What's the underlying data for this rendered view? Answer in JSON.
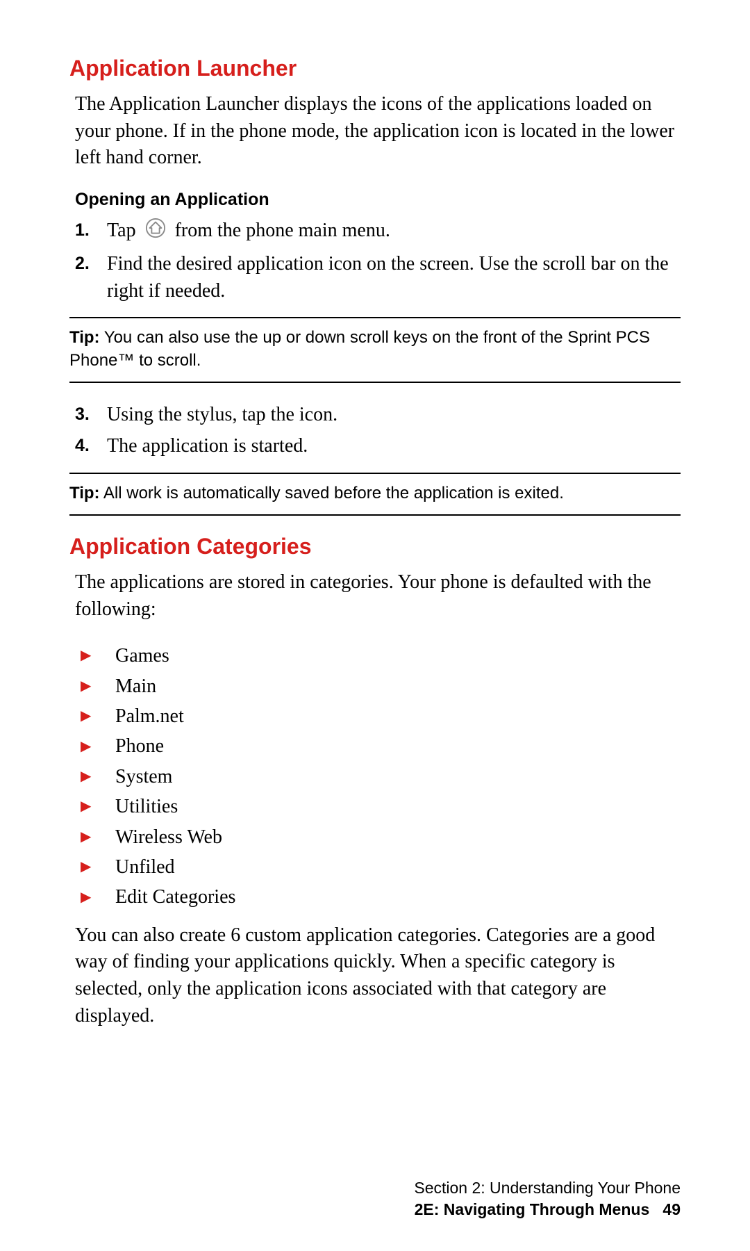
{
  "heading1": "Application Launcher",
  "intro1": "The Application Launcher displays the icons of the applications loaded on your phone. If in the phone mode, the application icon is located in the lower left hand corner.",
  "subheading1": "Opening an Application",
  "steps_a": [
    {
      "num": "1.",
      "pre": "Tap",
      "post": "from the phone main menu."
    },
    {
      "num": "2.",
      "text": "Find the desired application icon on the screen. Use the scroll bar on the right if needed."
    }
  ],
  "tip1_label": "Tip:",
  "tip1_text": "You can also use the up or down scroll keys on the front of the Sprint PCS Phone™ to scroll.",
  "steps_b": [
    {
      "num": "3.",
      "text": "Using the stylus, tap the icon."
    },
    {
      "num": "4.",
      "text": "The application is started."
    }
  ],
  "tip2_label": "Tip:",
  "tip2_text": "All work is automatically saved before the application is exited.",
  "heading2": "Application Categories",
  "intro2": "The applications are stored in categories. Your phone is defaulted with the following:",
  "categories": [
    "Games",
    "Main",
    "Palm.net",
    "Phone",
    "System",
    "Utilities",
    "Wireless Web",
    "Unfiled",
    "Edit Categories"
  ],
  "para2": "You can also create 6 custom application categories. Categories are a good way of finding your applications quickly. When a specific category is selected, only the application icons associated with that category are displayed.",
  "footer_section": "Section 2: Understanding Your Phone",
  "footer_chapter": "2E: Navigating Through Menus",
  "footer_page": "49"
}
